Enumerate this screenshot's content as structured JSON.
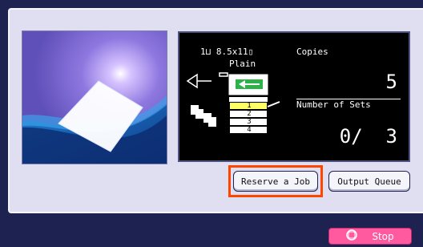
{
  "status": {
    "paper_info": "1⊔ 8.5x11▯",
    "paper_type": "Plain",
    "copies_label": "Copies",
    "copies_value": "5",
    "sets_label": "Number of Sets",
    "sets_value": "0/  3"
  },
  "trays": [
    "1",
    "2",
    "3",
    "4"
  ],
  "selected_tray": "1",
  "buttons": {
    "reserve_job": "Reserve a Job",
    "output_queue": "Output Queue",
    "stop": "Stop"
  },
  "colors": {
    "background": "#1e2250",
    "panel": "#e0dff2",
    "highlight_outline": "#ff4500",
    "stop_button": "#ff5aa0",
    "tray_selected": "#ffff66",
    "arrow_green": "#2bb34a"
  }
}
